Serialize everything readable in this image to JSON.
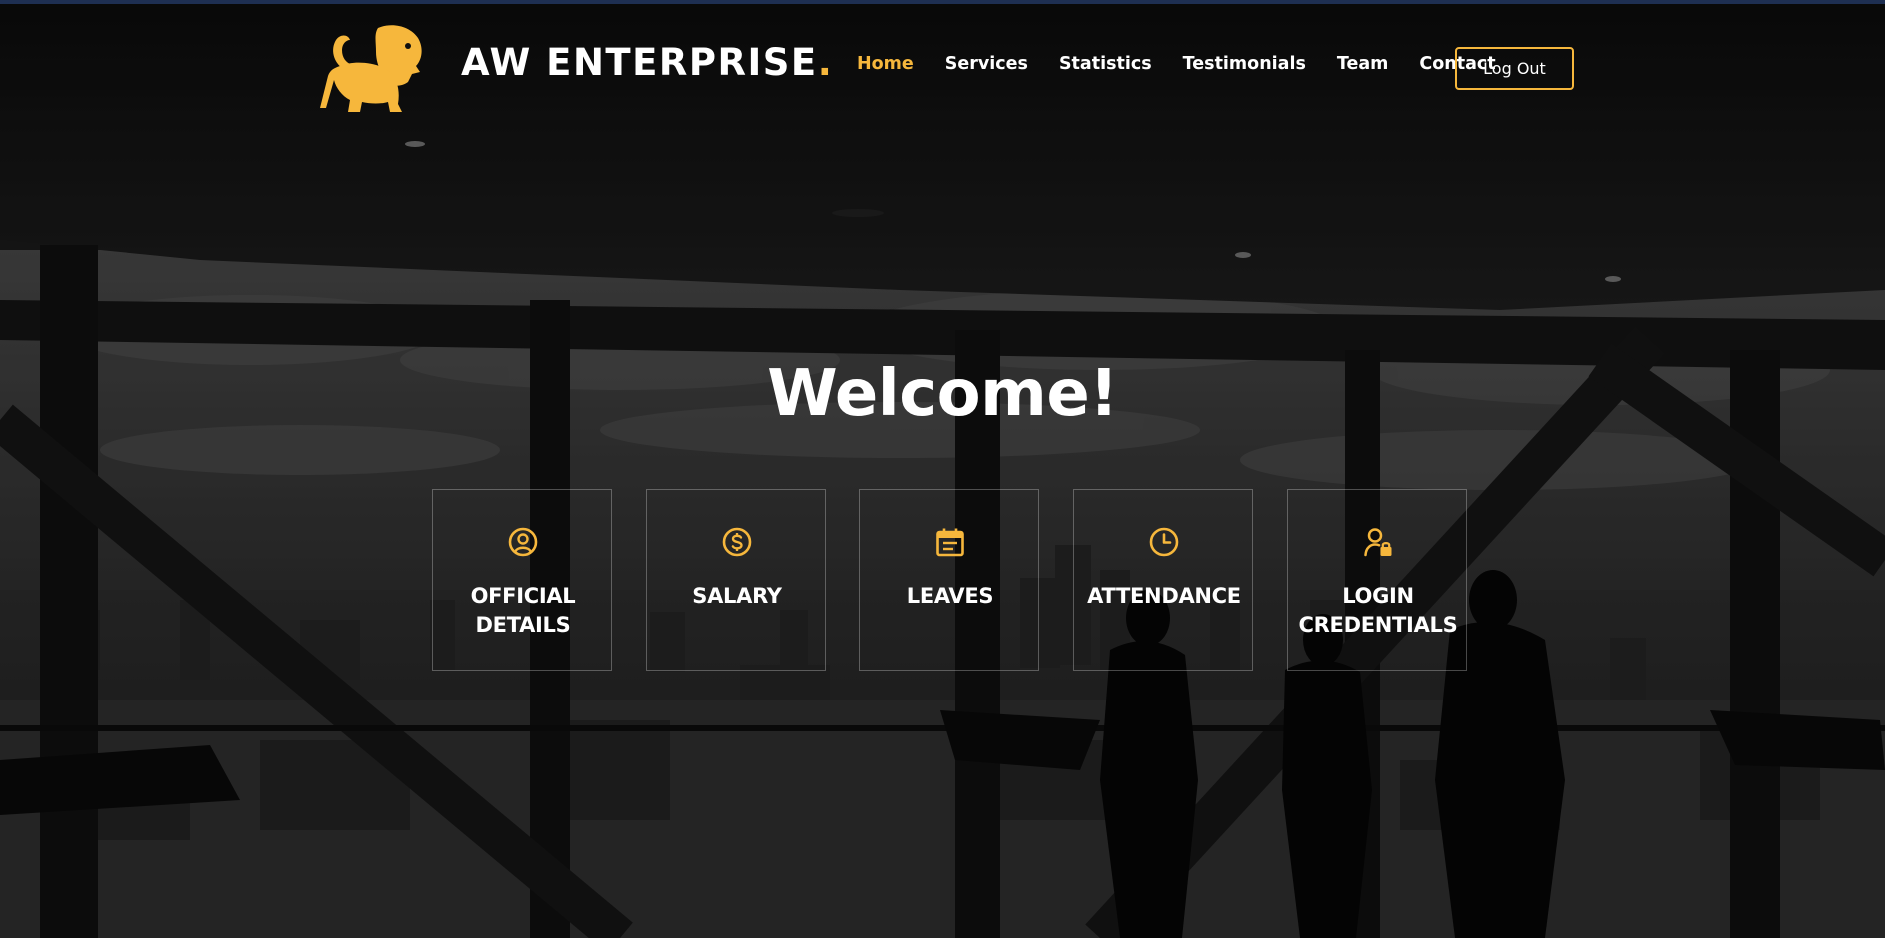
{
  "header": {
    "brand_name": "AW ENTERPRISE",
    "brand_dot": ".",
    "logo_icon": "lion-icon",
    "nav": [
      {
        "label": "Home",
        "active": true
      },
      {
        "label": "Services",
        "active": false
      },
      {
        "label": "Statistics",
        "active": false
      },
      {
        "label": "Testimonials",
        "active": false
      },
      {
        "label": "Team",
        "active": false
      },
      {
        "label": "Contact",
        "active": false
      }
    ],
    "logout_label": "Log Out"
  },
  "hero": {
    "title": "Welcome!",
    "cards": [
      {
        "label": "OFFICIAL DETAILS",
        "icon": "user-circle-icon"
      },
      {
        "label": "SALARY",
        "icon": "dollar-circle-icon"
      },
      {
        "label": "LEAVES",
        "icon": "calendar-icon"
      },
      {
        "label": "ATTENDANCE",
        "icon": "clock-icon"
      },
      {
        "label": "LOGIN CREDENTIALS",
        "icon": "user-lock-icon"
      }
    ]
  },
  "colors": {
    "accent": "#f6b73c",
    "text": "#ffffff",
    "background": "#1b1b1b"
  }
}
